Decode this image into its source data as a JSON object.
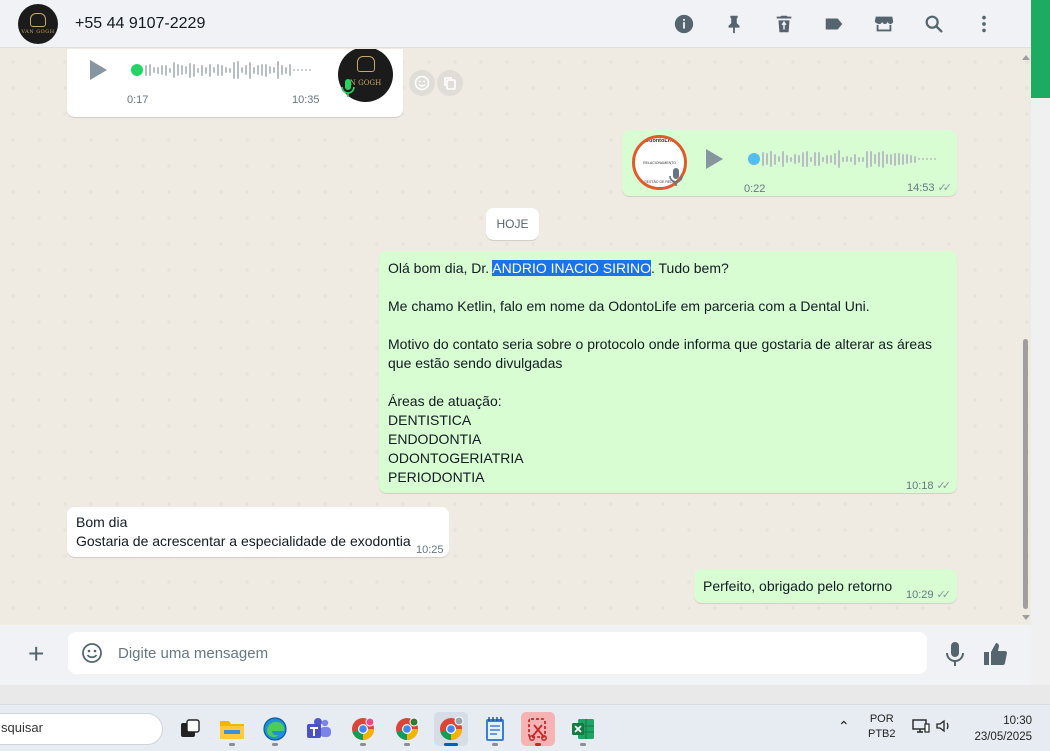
{
  "header": {
    "contact_name": "+55 44 9107-2229",
    "avatar_text": "VAN GOGH"
  },
  "voice_in": {
    "duration": "0:17",
    "time": "10:35",
    "avatar_text": "N GOGH"
  },
  "voice_out": {
    "duration": "0:22",
    "time": "14:53",
    "avatar_brand": "OdontoLife",
    "avatar_line1": "RELACIONAMENTO",
    "avatar_line2": "GESTÃO DE REDE"
  },
  "date_divider": "HOJE",
  "message_out_1": {
    "line_before": "Olá bom dia, Dr. ",
    "highlight": "ANDRIO INACIO SIRINO",
    "line_after": ". Tudo bem?",
    "p2": "Me chamo Ketlin, falo em nome da OdontoLife em parceria com a Dental Uni.",
    "p3": "Motivo do contato seria sobre o protocolo onde informa que gostaria de alterar as áreas que estão sendo divulgadas",
    "p4_title": "Áreas de atuação:",
    "areas": [
      "DENTISTICA",
      "ENDODONTIA",
      "ODONTOGERIATRIA",
      "PERIODONTIA"
    ],
    "time": "10:18"
  },
  "message_in_1": {
    "line1": "Bom dia",
    "line2": "Gostaria de acrescentar a especialidade de exodontia",
    "time": "10:25"
  },
  "message_out_2": {
    "text": "Perfeito, obrigado pelo retorno",
    "time": "10:29"
  },
  "composer": {
    "placeholder": "Digite uma mensagem"
  },
  "taskbar": {
    "search_text": "squisar",
    "lang_top": "POR",
    "lang_bottom": "PTB2",
    "clock_time": "10:30",
    "clock_date": "23/05/2025"
  },
  "colors": {
    "whatsapp_green": "#1daa61",
    "out_bubble": "#d9fdd3",
    "highlight": "#1a73e8"
  }
}
